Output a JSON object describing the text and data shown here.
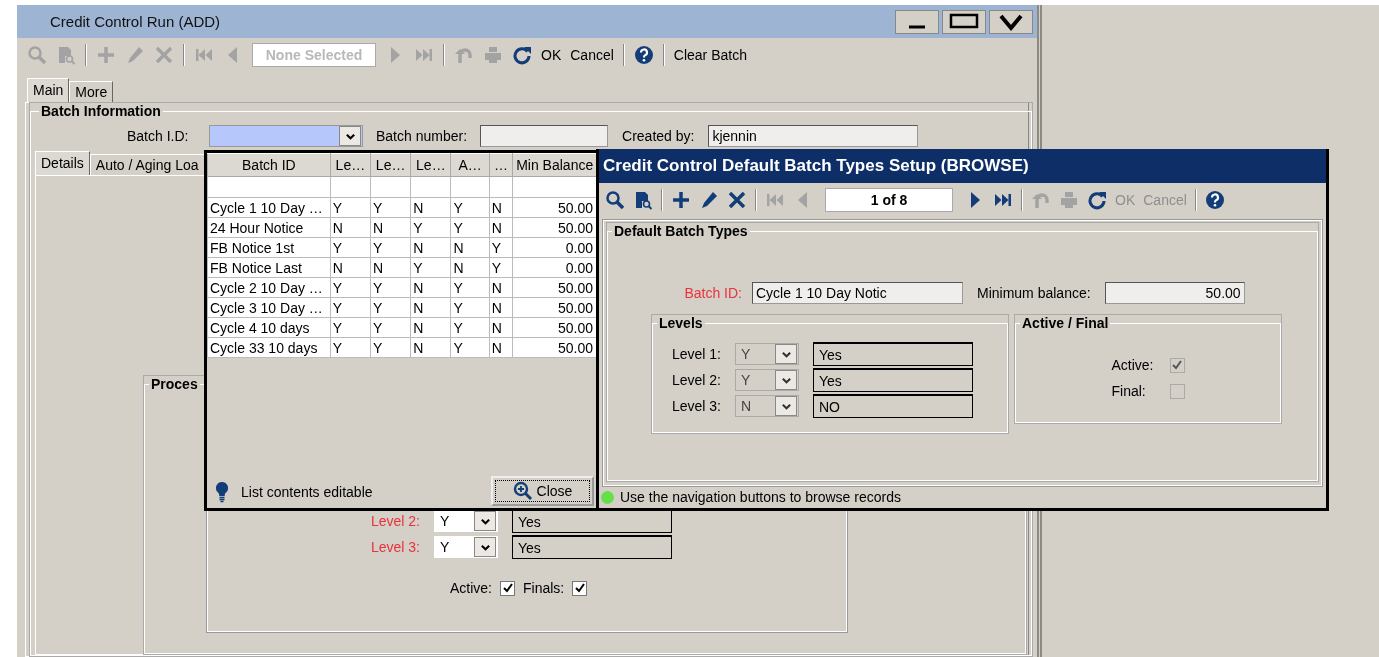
{
  "main_window": {
    "title": "Credit Control Run (ADD)",
    "toolbar": [
      {
        "kind": "icon",
        "disabled": true
      },
      {
        "kind": "icon",
        "disabled": true
      },
      {
        "kind": "separator"
      },
      {
        "kind": "icon",
        "disabled": true
      },
      {
        "kind": "icon",
        "disabled": true
      },
      {
        "kind": "icon",
        "disabled": true
      },
      {
        "kind": "separator"
      },
      {
        "kind": "icon",
        "disabled": true
      },
      {
        "kind": "icon",
        "disabled": true
      },
      {
        "kind": "field",
        "text": "None Selected",
        "disabled": true
      },
      {
        "kind": "icon",
        "disabled": true
      },
      {
        "kind": "icon",
        "disabled": true
      },
      {
        "kind": "separator"
      },
      {
        "kind": "icon",
        "disabled": true
      },
      {
        "kind": "icon",
        "disabled": true
      },
      {
        "kind": "icon",
        "disabled": false
      },
      {
        "kind": "text",
        "text": "OK",
        "disabled": false
      },
      {
        "kind": "text",
        "text": "Cancel",
        "disabled": false
      },
      {
        "kind": "separator"
      },
      {
        "kind": "icon",
        "disabled": false
      },
      {
        "kind": "separator"
      },
      {
        "kind": "text",
        "text": "Clear Batch",
        "disabled": false
      }
    ],
    "tabs": [
      {
        "label": "Main",
        "selected": true
      },
      {
        "label": "More",
        "selected": false
      }
    ],
    "batch_information": {
      "title": "Batch Information",
      "batch_id": {
        "label": "Batch I.D:",
        "focused": true
      },
      "batch_number": {
        "label": "Batch number:"
      },
      "created_by": {
        "label": "Created by:",
        "value": "kjennin"
      }
    },
    "sub_tabs": [
      {
        "label": "Details",
        "selected": true
      },
      {
        "label": "Auto / Aging Loa",
        "selected": false
      }
    ],
    "process_group": {
      "title": "Proces",
      "levels": [
        {
          "label": "Level 2:",
          "required": true,
          "code": "Y",
          "description": "Yes"
        },
        {
          "label": "Level 3:",
          "required": true,
          "code": "Y",
          "description": "Yes"
        }
      ],
      "checks": [
        {
          "label": "Active:",
          "checked": true,
          "disabled": false
        },
        {
          "label": "Finals:",
          "checked": true,
          "disabled": false
        }
      ]
    }
  },
  "lookup_list": {
    "columns": [
      "Batch ID",
      "Le…",
      "Le…",
      "Le…",
      "A…",
      "…",
      "Min Balance"
    ],
    "rows": [
      [
        "Cycle 1 10 Day …",
        "Y",
        "Y",
        "N",
        "Y",
        "N",
        "50.00"
      ],
      [
        "24 Hour Notice",
        "N",
        "N",
        "Y",
        "Y",
        "N",
        "50.00"
      ],
      [
        "FB Notice 1st",
        "Y",
        "Y",
        "N",
        "N",
        "Y",
        "0.00"
      ],
      [
        "FB Notice Last",
        "N",
        "N",
        "Y",
        "N",
        "Y",
        "0.00"
      ],
      [
        "Cycle 2 10 Day …",
        "Y",
        "Y",
        "N",
        "Y",
        "N",
        "50.00"
      ],
      [
        "Cycle 3 10 Day …",
        "Y",
        "Y",
        "N",
        "Y",
        "N",
        "50.00"
      ],
      [
        "Cycle 4 10 days",
        "Y",
        "Y",
        "N",
        "Y",
        "N",
        "50.00"
      ],
      [
        "Cycle 33 10 days",
        "Y",
        "Y",
        "N",
        "Y",
        "N",
        "50.00"
      ]
    ],
    "hint": "List contents editable",
    "close_button": "Close"
  },
  "browse_dialog": {
    "title": "Credit Control Default Batch Types Setup (BROWSE)",
    "toolbar": [
      {
        "kind": "icon",
        "disabled": false
      },
      {
        "kind": "icon",
        "disabled": false
      },
      {
        "kind": "separator"
      },
      {
        "kind": "icon",
        "disabled": false
      },
      {
        "kind": "icon",
        "disabled": false
      },
      {
        "kind": "icon",
        "disabled": false
      },
      {
        "kind": "separator"
      },
      {
        "kind": "icon",
        "disabled": true
      },
      {
        "kind": "icon",
        "disabled": true
      },
      {
        "kind": "field",
        "text": "1 of 8",
        "disabled": false
      },
      {
        "kind": "icon",
        "disabled": false
      },
      {
        "kind": "icon",
        "disabled": false
      },
      {
        "kind": "separator"
      },
      {
        "kind": "icon",
        "disabled": true
      },
      {
        "kind": "icon",
        "disabled": true
      },
      {
        "kind": "icon",
        "disabled": false
      },
      {
        "kind": "text",
        "text": "OK",
        "disabled": true
      },
      {
        "kind": "text",
        "text": "Cancel",
        "disabled": true
      },
      {
        "kind": "separator"
      },
      {
        "kind": "icon",
        "disabled": false
      }
    ],
    "group_title": "Default Batch Types",
    "batch_id": {
      "label": "Batch ID:",
      "required": true,
      "value": "Cycle 1 10 Day Notic"
    },
    "minimum_balance": {
      "label": "Minimum balance:",
      "value": "50.00"
    },
    "levels": {
      "title": "Levels",
      "items": [
        {
          "label": "Level 1:",
          "required": false,
          "code": "Y",
          "description": "Yes"
        },
        {
          "label": "Level 2:",
          "required": false,
          "code": "Y",
          "description": "Yes"
        },
        {
          "label": "Level 3:",
          "required": false,
          "code": "N",
          "description": "NO"
        }
      ]
    },
    "active_final": {
      "title": "Active / Final",
      "checks": [
        {
          "label": "Active:",
          "checked": true,
          "disabled": true
        },
        {
          "label": "Final:",
          "checked": false,
          "disabled": true
        }
      ]
    },
    "status": "Use the navigation buttons to browse records"
  }
}
